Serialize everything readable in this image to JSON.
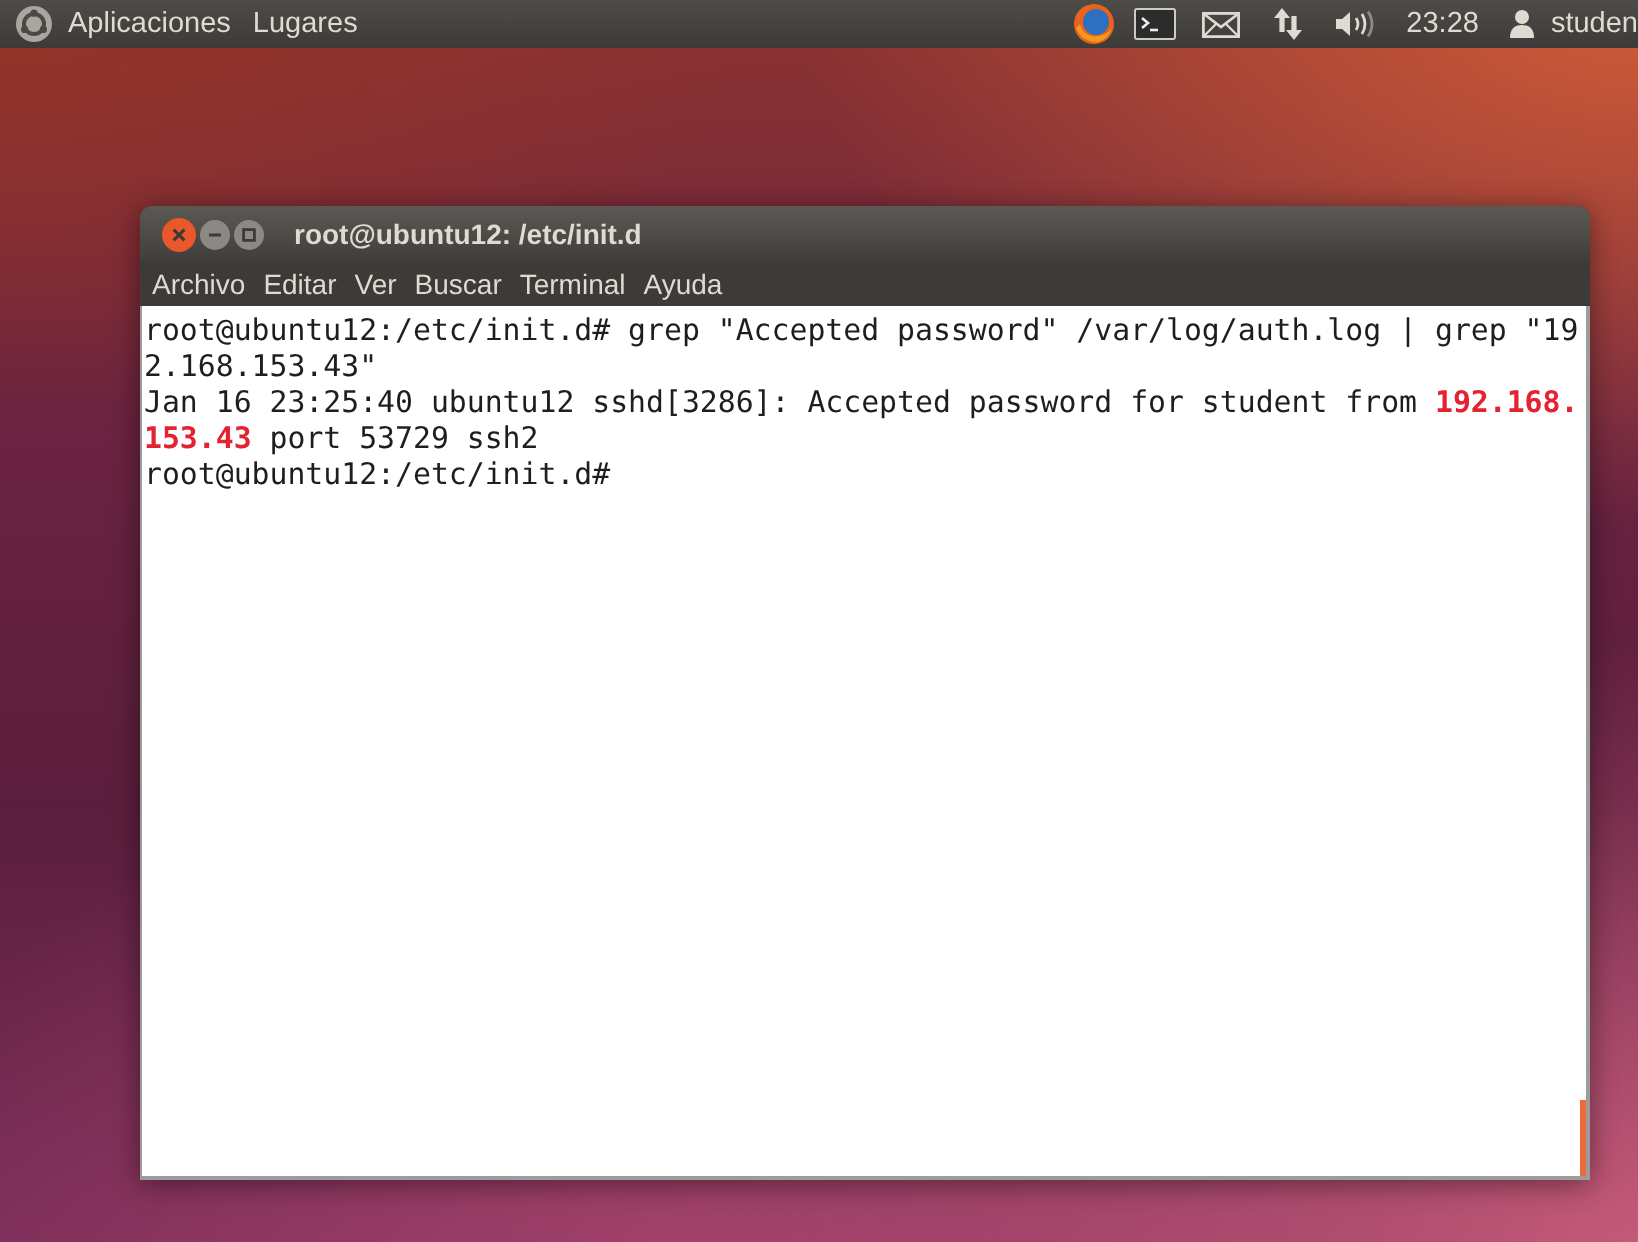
{
  "top_panel": {
    "menus": [
      "Aplicaciones",
      "Lugares"
    ],
    "clock": "23:28",
    "user": "studen"
  },
  "window": {
    "title": "root@ubuntu12: /etc/init.d",
    "menu": [
      "Archivo",
      "Editar",
      "Ver",
      "Buscar",
      "Terminal",
      "Ayuda"
    ],
    "terminal_lines": [
      {
        "segments": [
          {
            "text": "root@ubuntu12:/etc/init.d# grep \"Accepted password\" /var/log/auth.log | grep \"19",
            "highlight": false
          }
        ]
      },
      {
        "segments": [
          {
            "text": "2.168.153.43\"",
            "highlight": false
          }
        ]
      },
      {
        "segments": [
          {
            "text": "Jan 16 23:25:40 ubuntu12 sshd[3286]: Accepted password for student from ",
            "highlight": false
          },
          {
            "text": "192.168.",
            "highlight": true
          }
        ]
      },
      {
        "segments": [
          {
            "text": "153.43",
            "highlight": true
          },
          {
            "text": " port 53729 ssh2",
            "highlight": false
          }
        ]
      },
      {
        "segments": [
          {
            "text": "root@ubuntu12:/etc/init.d#",
            "highlight": false
          }
        ]
      }
    ]
  }
}
